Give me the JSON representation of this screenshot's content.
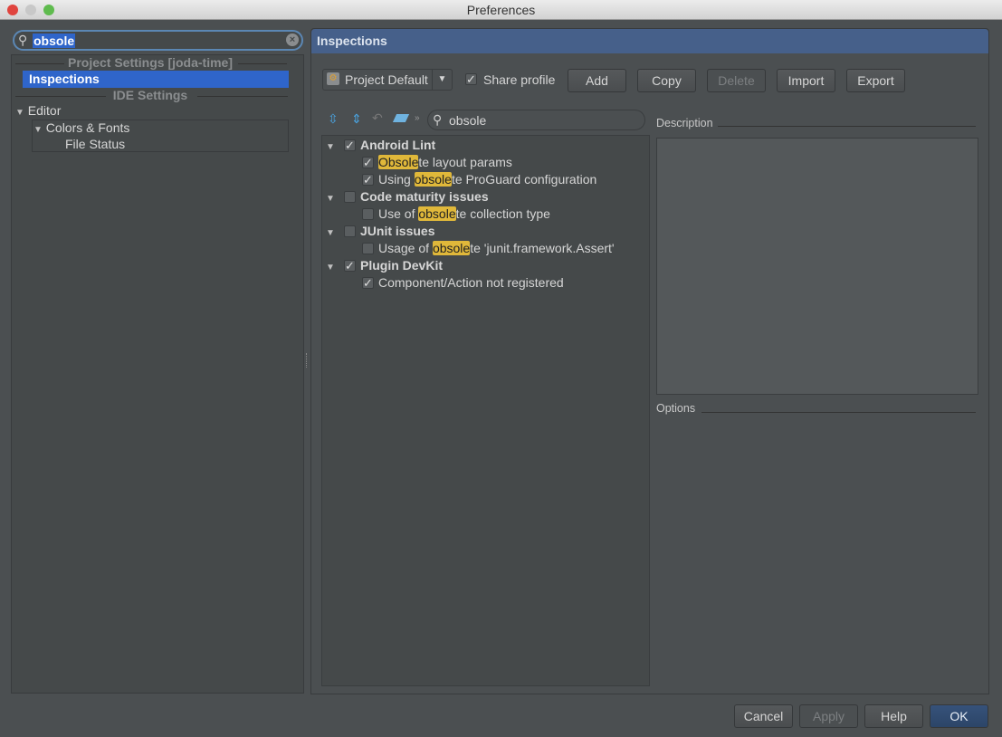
{
  "window": {
    "title": "Preferences"
  },
  "sidebar": {
    "search_value": "obsole",
    "project_section": "Project Settings [joda-time]",
    "selected_item": "Inspections",
    "ide_section": "IDE Settings",
    "tree": [
      {
        "label": "Editor",
        "expanded": true
      },
      {
        "label": "Colors & Fonts",
        "expanded": true
      },
      {
        "label": "File Status"
      }
    ]
  },
  "panel": {
    "title": "Inspections",
    "profile": "Project Default",
    "share_profile_label": "Share profile",
    "share_profile_checked": true,
    "buttons": {
      "add": "Add",
      "copy": "Copy",
      "delete": "Delete",
      "import": "Import",
      "export": "Export"
    },
    "filter_value": "obsole",
    "tree": [
      {
        "group": "Android Lint",
        "checked": true,
        "items": [
          {
            "pre": "",
            "hl": "Obsole",
            "post": "te layout params",
            "checked": true
          },
          {
            "pre": "Using ",
            "hl": "obsole",
            "post": "te ProGuard configuration",
            "checked": true
          }
        ]
      },
      {
        "group": "Code maturity issues",
        "checked": false,
        "items": [
          {
            "pre": "Use of ",
            "hl": "obsole",
            "post": "te collection type",
            "checked": false
          }
        ]
      },
      {
        "group": "JUnit issues",
        "checked": false,
        "items": [
          {
            "pre": "Usage of ",
            "hl": "obsole",
            "post": "te 'junit.framework.Assert'",
            "checked": false
          }
        ]
      },
      {
        "group": "Plugin DevKit",
        "checked": true,
        "items": [
          {
            "pre": "Component/Action not registered",
            "hl": "",
            "post": "",
            "checked": true
          }
        ]
      }
    ],
    "description_label": "Description",
    "options_label": "Options"
  },
  "footer": {
    "cancel": "Cancel",
    "apply": "Apply",
    "help": "Help",
    "ok": "OK"
  },
  "colors": {
    "accent": "#2f65ca",
    "header": "#46608a",
    "highlight": "#e0b83a"
  }
}
